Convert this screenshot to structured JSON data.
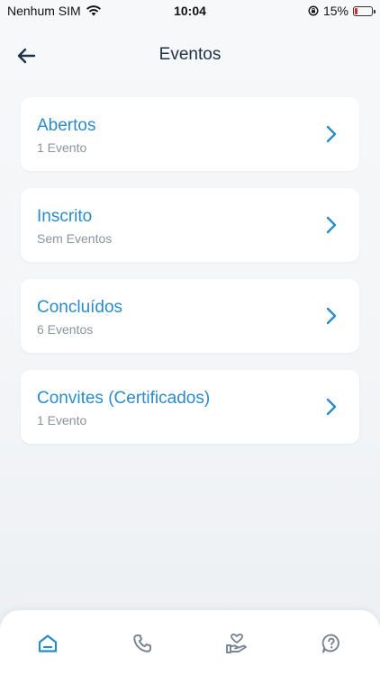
{
  "status_bar": {
    "carrier": "Nenhum SIM",
    "time": "10:04",
    "battery": "15%",
    "battery_level": 0.15,
    "icons": [
      "wifi-icon",
      "orientation-lock-icon",
      "battery-icon"
    ]
  },
  "header": {
    "title": "Eventos",
    "back_icon": "arrow-left-icon"
  },
  "categories": [
    {
      "title": "Abertos",
      "subtitle": "1 Evento"
    },
    {
      "title": "Inscrito",
      "subtitle": "Sem Eventos"
    },
    {
      "title": "Concluídos",
      "subtitle": "6 Eventos"
    },
    {
      "title": "Convites (Certificados)",
      "subtitle": "1 Evento"
    }
  ],
  "bottom_nav": {
    "items": [
      "home-icon",
      "phone-icon",
      "hand-heart-icon",
      "help-icon"
    ],
    "active": "home-icon"
  },
  "colors": {
    "accent": "#2a8bc8",
    "title": "#1e3246",
    "subtitle": "#8a949e",
    "nav_icon": "#7a8591",
    "battery_low": "#e0232a"
  }
}
